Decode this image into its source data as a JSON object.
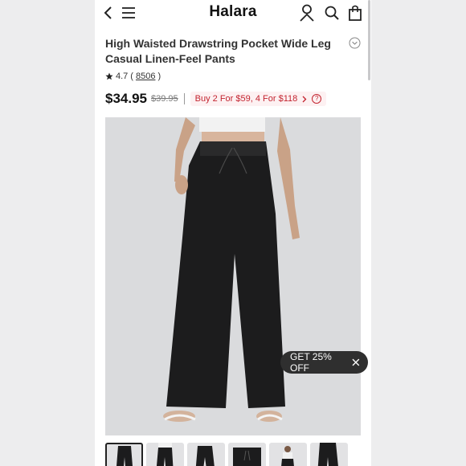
{
  "header": {
    "brand": "Halara",
    "icons": [
      "back-icon",
      "menu-icon",
      "user-icon",
      "search-icon",
      "bag-icon"
    ]
  },
  "product": {
    "title": "High Waisted Drawstring Pocket Wide Leg Casual Linen-Feel Pants",
    "rating": "4.7",
    "review_count": "8506",
    "price": "$34.95",
    "original_price": "$39.95",
    "promo": "Buy 2 For $59, 4 For $118"
  },
  "discount_button": {
    "label": "GET 25% OFF"
  },
  "thumbnails": {
    "count": 6,
    "selected_index": 0
  },
  "colors": {
    "promo_text": "#c3232f",
    "promo_bg": "#fdf1f2",
    "discount_bg": "#2f2f2f",
    "hero_bg": "#dadbdd"
  }
}
